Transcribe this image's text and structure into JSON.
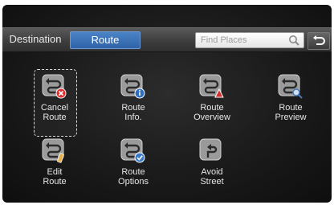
{
  "tabs": {
    "destination_label": "Destination",
    "route_label": "Route"
  },
  "search": {
    "placeholder": "Find Places"
  },
  "accent_color": "#3a70b4",
  "menu": {
    "items": [
      {
        "label": "Cancel\nRoute",
        "icon": "cancel-route-icon",
        "selected": true
      },
      {
        "label": "Route\nInfo.",
        "icon": "route-info-icon",
        "selected": false
      },
      {
        "label": "Route\nOverview",
        "icon": "route-overview-icon",
        "selected": false
      },
      {
        "label": "Route\nPreview",
        "icon": "route-preview-icon",
        "selected": false
      },
      {
        "label": "Edit\nRoute",
        "icon": "edit-route-icon",
        "selected": false
      },
      {
        "label": "Route\nOptions",
        "icon": "route-options-icon",
        "selected": false
      },
      {
        "label": "Avoid\nStreet",
        "icon": "avoid-street-icon",
        "selected": false
      }
    ]
  }
}
